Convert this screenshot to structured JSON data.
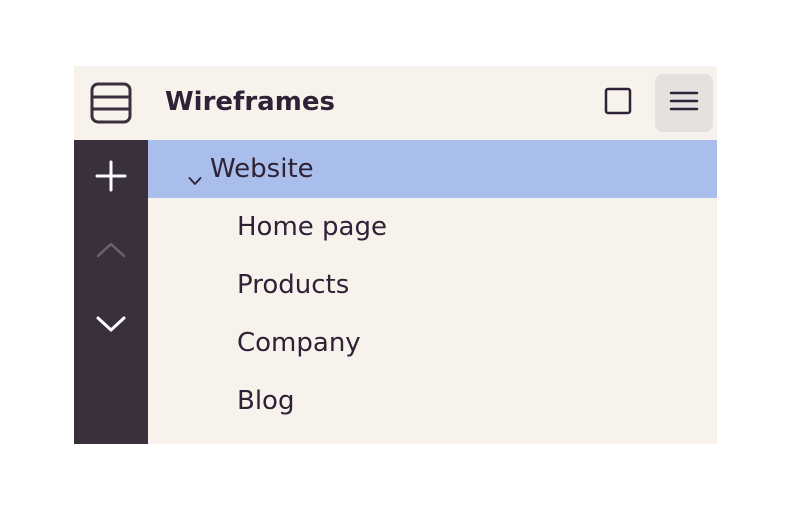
{
  "header": {
    "app_icon": "layers-icon",
    "title": "Wireframes",
    "square_button_icon": "square-icon",
    "menu_button_icon": "hamburger-menu-icon"
  },
  "toolbar": {
    "add_icon": "plus-icon",
    "move_up_icon": "chevron-up-icon",
    "move_down_icon": "chevron-down-icon"
  },
  "tree": {
    "root": {
      "label": "Website",
      "expanded": true,
      "selected": true,
      "icon": "chevron-down-icon"
    },
    "children": [
      {
        "label": "Home page"
      },
      {
        "label": "Products"
      },
      {
        "label": "Company"
      },
      {
        "label": "Blog"
      }
    ]
  },
  "colors": {
    "panel_bg": "#f7f2ec",
    "toolbar_bg": "#3a2f3d",
    "selected_row": "#aabeeb",
    "text": "#2e2236",
    "active_button_bg": "#e4e1df"
  }
}
